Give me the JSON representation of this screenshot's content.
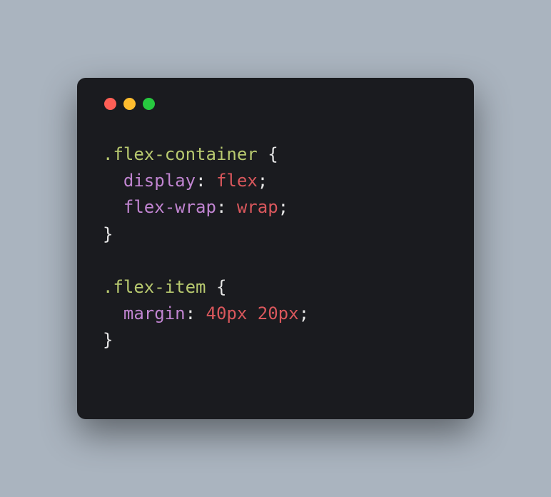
{
  "code": {
    "rule1": {
      "selector": ".flex-container",
      "decl1": {
        "property": "display",
        "value": "flex"
      },
      "decl2": {
        "property": "flex-wrap",
        "value": "wrap"
      }
    },
    "rule2": {
      "selector": ".flex-item",
      "decl1": {
        "property": "margin",
        "value": "40px 20px"
      }
    }
  },
  "tokens": {
    "open_brace": " {",
    "close_brace": "}",
    "colon": ": ",
    "semi": ";",
    "indent": "  "
  }
}
